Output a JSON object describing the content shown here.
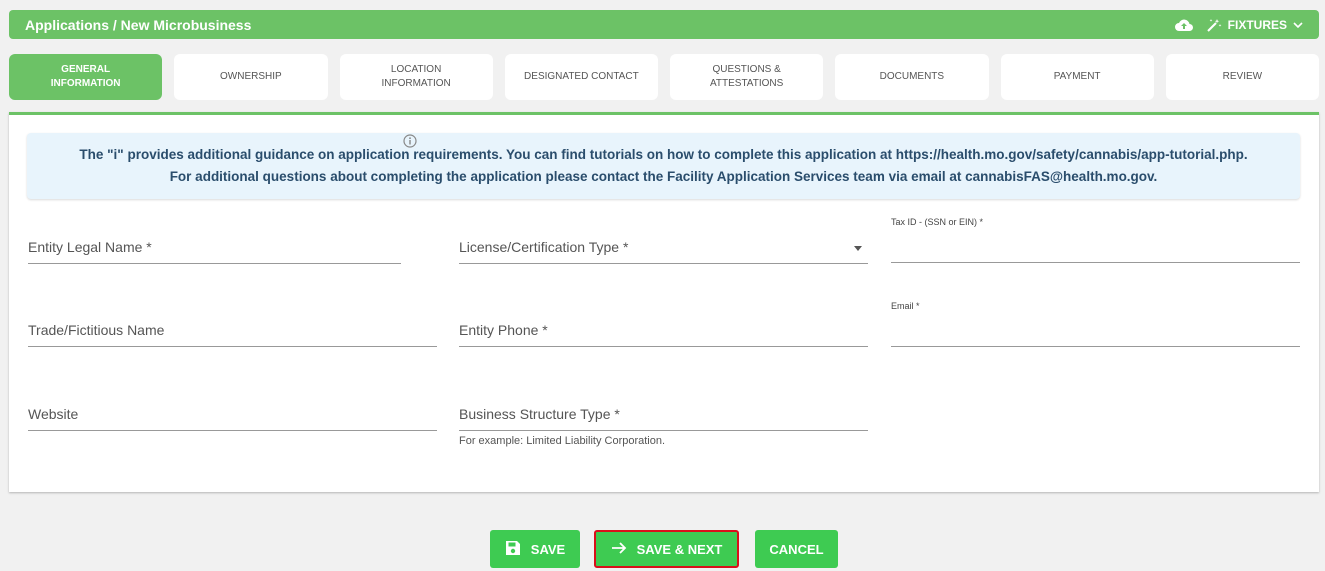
{
  "header": {
    "breadcrumb": "Applications / New Microbusiness",
    "fixtures_label": "FIXTURES"
  },
  "tabs": [
    {
      "label": "GENERAL\nINFORMATION",
      "active": true
    },
    {
      "label": "OWNERSHIP",
      "active": false
    },
    {
      "label": "LOCATION\nINFORMATION",
      "active": false
    },
    {
      "label": "DESIGNATED CONTACT",
      "active": false
    },
    {
      "label": "QUESTIONS &\nATTESTATIONS",
      "active": false
    },
    {
      "label": "DOCUMENTS",
      "active": false
    },
    {
      "label": "PAYMENT",
      "active": false
    },
    {
      "label": "REVIEW",
      "active": false
    }
  ],
  "info_text": "The \"i\" provides additional guidance on application requirements. You can find tutorials on how to complete this application at https://health.mo.gov/safety/cannabis/app-tutorial.php. For additional questions about completing the application please contact the Facility Application Services team via email at cannabisFAS@health.mo.gov.",
  "fields": {
    "entity_legal_name": "Entity Legal Name *",
    "license_type": "License/Certification Type *",
    "tax_id": "Tax ID - (SSN or EIN) *",
    "trade_name": "Trade/Fictitious Name",
    "entity_phone": "Entity Phone *",
    "email": "Email *",
    "website": "Website",
    "business_structure": "Business Structure Type *",
    "business_structure_hint": "For example: Limited Liability Corporation."
  },
  "buttons": {
    "save": "SAVE",
    "save_next": "SAVE & NEXT",
    "cancel": "CANCEL"
  },
  "colors": {
    "brand_green": "#6cc266",
    "button_green": "#3ecb52",
    "highlight_red": "#d9101a",
    "info_bg": "#e8f4fc"
  }
}
